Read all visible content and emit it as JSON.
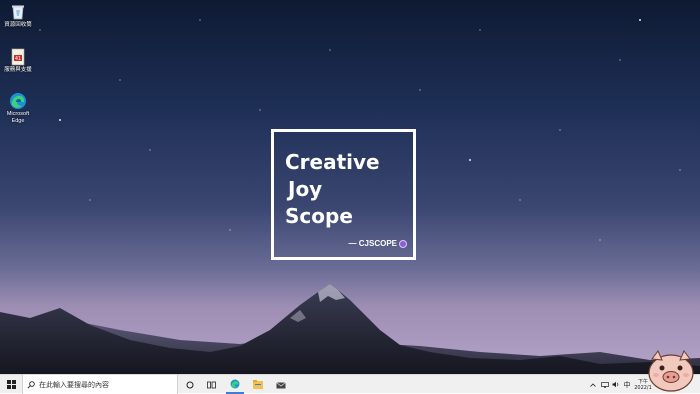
{
  "desktop": {
    "icons": [
      {
        "label": "資源回收筒",
        "icon": "recycle-bin-icon"
      },
      {
        "label": "服務與支援",
        "icon": "support-app-icon"
      },
      {
        "label": "Microsoft Edge",
        "icon": "edge-icon"
      }
    ],
    "wallpaper": {
      "line1": "Creative",
      "line2": "Joy",
      "line3": "Scope",
      "signature": "— CJSCOPE"
    }
  },
  "taskbar": {
    "search_placeholder": "在此輸入要搜尋的內容",
    "apps": [
      "cortana-icon",
      "task-view-icon",
      "edge-icon",
      "file-explorer-icon",
      "mail-icon"
    ],
    "tray": {
      "ime": "中",
      "clock_time": "下午",
      "clock_date": "2022/1"
    }
  },
  "colors": {
    "sky_top": "#0e1a33",
    "sky_bottom": "#b5a4c9",
    "taskbar_bg": "#f0f0f0",
    "accent": "#8a5fd0"
  }
}
